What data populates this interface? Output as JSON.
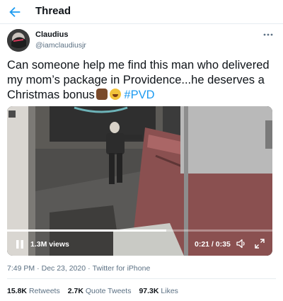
{
  "header": {
    "title": "Thread",
    "back_icon": "arrow-left-icon",
    "accent": "#1d9bf0"
  },
  "author": {
    "display_name": "Claudius",
    "handle": "@iamclaudiusjr",
    "more_icon": "more-horizontal-icon"
  },
  "tweet": {
    "text": "Can someone help me find this man who delivered my mom’s package in Providence...he deserves a Christmas bonus",
    "emojis": [
      "raised-fist-dark-skin",
      "face-with-tears-of-joy"
    ],
    "hashtag": "#PVD"
  },
  "media": {
    "views": "1.3M views",
    "time": "0:21 / 0:35",
    "progress": 0.6,
    "icons": [
      "pause-icon",
      "volume-icon",
      "fullscreen-icon"
    ]
  },
  "meta": {
    "time": "7:49 PM",
    "separator": "·",
    "date": "Dec 23, 2020",
    "source": "Twitter for iPhone"
  },
  "stats": {
    "retweets_count": "15.8K",
    "retweets_label": "Retweets",
    "quotes_count": "2.7K",
    "quotes_label": "Quote Tweets",
    "likes_count": "97.3K",
    "likes_label": "Likes"
  }
}
